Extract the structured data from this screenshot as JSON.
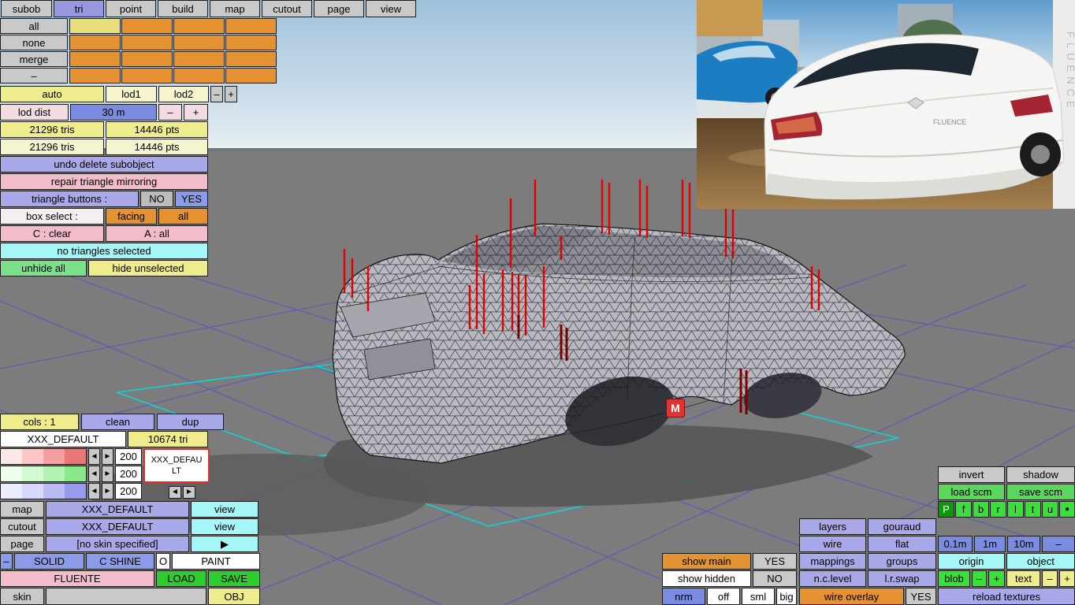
{
  "colors": {
    "accent_orange": "#e59232",
    "panel_lavender": "#a9a9ea",
    "panel_yellow": "#efec8e",
    "panel_pink": "#f3bcca",
    "panel_cyan": "#a5f6f6",
    "button_green": "#2ecc2e",
    "panel_blue": "#8b9bea",
    "viewport_gray": "#7c7c7c",
    "wire_blue": "#4040e0",
    "highlight_cyan": "#00dede",
    "spike_red": "#e50000",
    "tab_active": "#9898e0"
  },
  "tabs": {
    "items": [
      "subob",
      "tri",
      "point",
      "build",
      "map",
      "cutout",
      "page",
      "view"
    ],
    "active": "tri"
  },
  "subobj": {
    "row_buttons": [
      "all",
      "none",
      "merge",
      "–"
    ]
  },
  "lod": {
    "auto": "auto",
    "lod1": "lod1",
    "lod2": "lod2",
    "minus": "–",
    "plus": "+",
    "dist_label": "lod dist",
    "dist_value": "30 m",
    "dist_minus": "–",
    "dist_plus": "+"
  },
  "stats": {
    "tris1": "21296 tris",
    "pts1": "14446 pts",
    "tris2": "21296 tris",
    "pts2": "14446 pts"
  },
  "tools": {
    "undo": "undo delete subobject",
    "repair": "repair triangle mirroring",
    "triangle_buttons_label": "triangle buttons :",
    "no": "NO",
    "yes": "YES",
    "box_select_label": "box select :",
    "facing": "facing",
    "all": "all",
    "c_clear": "C : clear",
    "a_all": "A : all",
    "status": "no triangles selected",
    "unhide": "unhide all",
    "hide": "hide unselected"
  },
  "materials": {
    "cols": "cols : 1",
    "clean": "clean",
    "dup": "dup",
    "name": "XXX_DEFAULT",
    "tri_count": "10674 tri",
    "r": "200",
    "g": "200",
    "b": "200",
    "left_arrow": "◄",
    "right_arrow": "►",
    "preview_line1": "XXX_DEFAU",
    "preview_line2": "LT",
    "map_label": "map",
    "map_value": "XXX_DEFAULT",
    "map_view": "view",
    "cutout_label": "cutout",
    "cutout_value": "XXX_DEFAULT",
    "cutout_view": "view",
    "page_label": "page",
    "page_value": "[no skin specified]",
    "page_arrow": "▶",
    "minus": "–",
    "solid": "SOLID",
    "c_shine": "C SHINE",
    "o": "O",
    "paint": "PAINT",
    "skin_name": "FLUENTE",
    "load": "LOAD",
    "save": "SAVE",
    "skin_label": "skin",
    "obj": "OBJ"
  },
  "right_panel": {
    "invert": "invert",
    "shadow": "shadow",
    "load_scm": "load scm",
    "save_scm": "save scm",
    "axis_buttons": [
      "P",
      "f",
      "b",
      "r",
      "l",
      "t",
      "u",
      "●"
    ],
    "layers": "layers",
    "gouraud": "gouraud",
    "wire": "wire",
    "flat": "flat",
    "grid_sizes": [
      "0.1m",
      "1m",
      "10m",
      "–"
    ],
    "show_main": "show main",
    "show_main_val": "YES",
    "mappings": "mappings",
    "groups": "groups",
    "origin": "origin",
    "object": "object",
    "show_hidden": "show hidden",
    "show_hidden_val": "NO",
    "nc_level": "n.c.level",
    "lr_swap": "l.r.swap",
    "blob": "blob",
    "blob_minus": "–",
    "blob_plus": "+",
    "text": "text",
    "text_minus": "–",
    "text_plus": "+",
    "nrm": "nrm",
    "off": "off",
    "sml": "sml",
    "big": "big",
    "wire_overlay": "wire overlay",
    "wire_overlay_val": "YES",
    "reload_textures": "reload textures"
  },
  "viewport": {
    "marker": "M"
  },
  "reference_photo": {
    "model_name": "FLUENCE"
  }
}
